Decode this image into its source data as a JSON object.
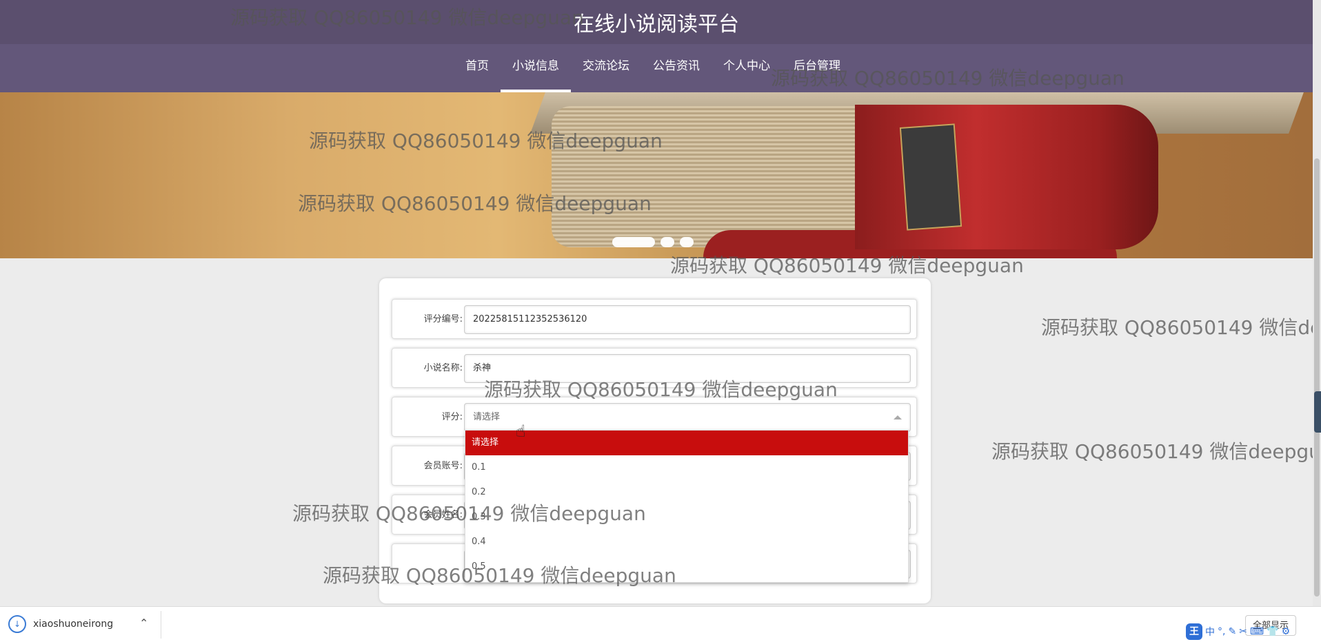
{
  "site": {
    "title": "在线小说阅读平台"
  },
  "nav": {
    "items": [
      {
        "label": "首页"
      },
      {
        "label": "小说信息"
      },
      {
        "label": "交流论坛"
      },
      {
        "label": "公告资讯"
      },
      {
        "label": "个人中心"
      },
      {
        "label": "后台管理"
      }
    ],
    "active_index": 1
  },
  "banner": {
    "slides_count": 3,
    "active_slide": 1
  },
  "form": {
    "fields": [
      {
        "label": "评分编号:",
        "value": "20225815112352536120"
      },
      {
        "label": "小说名称:",
        "value": "杀神"
      },
      {
        "label": "评分:",
        "value": "请选择"
      },
      {
        "label": "会员账号:",
        "value": ""
      },
      {
        "label": "会员姓名:",
        "value": ""
      },
      {
        "label": "",
        "value": ""
      }
    ]
  },
  "rating_dropdown": {
    "options": [
      "请选择",
      "0.1",
      "0.2",
      "0.3",
      "0.4",
      "0.5"
    ],
    "selected": "请选择"
  },
  "watermark": {
    "text": "源码获取 QQ86050149 微信deepguan"
  },
  "taskbar": {
    "download_name": "xiaoshuoneirong",
    "show_all_label": "全部显示"
  },
  "ime": {
    "logo": "王",
    "mode": "中"
  }
}
